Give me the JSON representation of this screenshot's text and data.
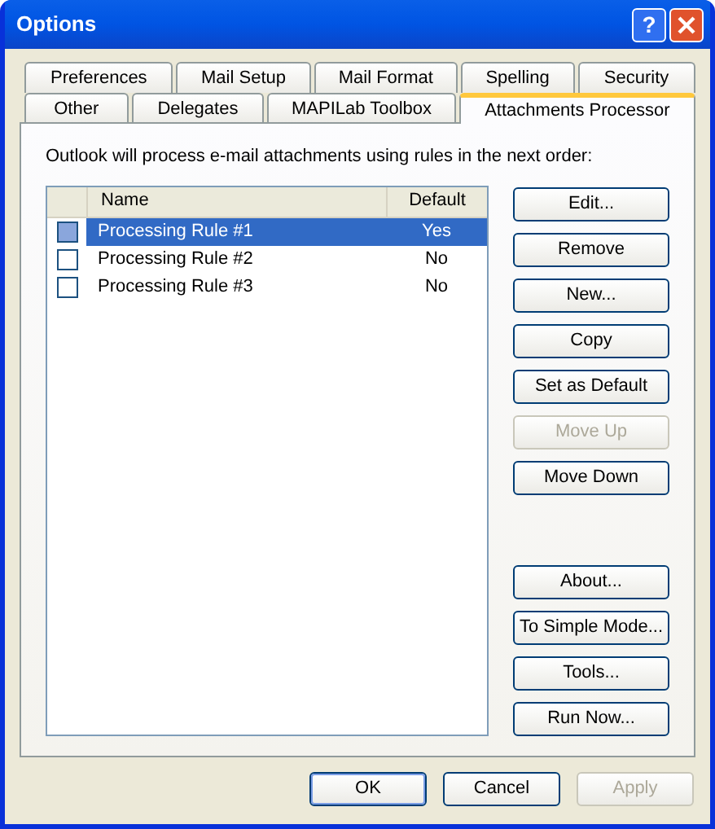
{
  "window": {
    "title": "Options"
  },
  "title_buttons": [
    {
      "kind": "help",
      "label": "?"
    },
    {
      "kind": "close"
    }
  ],
  "tab_rows": [
    [
      {
        "label": "Preferences",
        "selected": false
      },
      {
        "label": "Mail Setup",
        "selected": false
      },
      {
        "label": "Mail Format",
        "selected": false
      },
      {
        "label": "Spelling",
        "selected": false
      },
      {
        "label": "Security",
        "selected": false
      }
    ],
    [
      {
        "label": "Other",
        "selected": false
      },
      {
        "label": "Delegates",
        "selected": false
      },
      {
        "label": "MAPILab Toolbox",
        "selected": false
      },
      {
        "label": "Attachments Processor",
        "selected": true
      }
    ]
  ],
  "description": "Outlook will process e-mail attachments using rules in the next order:",
  "table": {
    "columns": [
      "Name",
      "Default"
    ],
    "rows": [
      {
        "name": "Processing Rule #1",
        "default": "Yes",
        "checked": false,
        "selected": true
      },
      {
        "name": "Processing Rule #2",
        "default": "No",
        "checked": false,
        "selected": false
      },
      {
        "name": "Processing Rule #3",
        "default": "No",
        "checked": false,
        "selected": false
      }
    ]
  },
  "side_buttons": [
    [
      {
        "label": "Edit...",
        "disabled": false
      },
      {
        "label": "Remove",
        "disabled": false
      },
      {
        "label": "New...",
        "disabled": false
      },
      {
        "label": "Copy",
        "disabled": false
      },
      {
        "label": "Set as Default",
        "disabled": false
      },
      {
        "label": "Move Up",
        "disabled": true
      },
      {
        "label": "Move Down",
        "disabled": false
      }
    ],
    [
      {
        "label": "About...",
        "disabled": false
      },
      {
        "label": "To Simple Mode...",
        "disabled": false
      },
      {
        "label": "Tools...",
        "disabled": false
      },
      {
        "label": "Run Now...",
        "disabled": false
      }
    ]
  ],
  "footer_buttons": [
    {
      "label": "OK",
      "disabled": false,
      "default": true
    },
    {
      "label": "Cancel",
      "disabled": false,
      "default": false
    },
    {
      "label": "Apply",
      "disabled": true,
      "default": false
    }
  ]
}
